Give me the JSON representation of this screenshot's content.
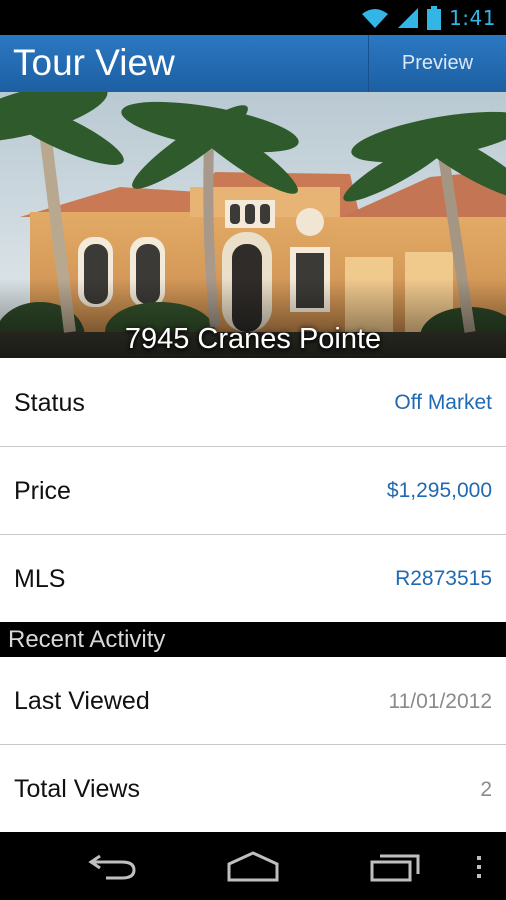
{
  "status_bar": {
    "time": "1:41",
    "icons": [
      "wifi-icon",
      "signal-icon",
      "battery-icon"
    ]
  },
  "action_bar": {
    "title": "Tour View",
    "preview_label": "Preview"
  },
  "hero": {
    "address": "7945 Cranes Pointe"
  },
  "details": [
    {
      "label": "Status",
      "value": "Off Market"
    },
    {
      "label": "Price",
      "value": "$1,295,000"
    },
    {
      "label": "MLS",
      "value": "R2873515"
    }
  ],
  "recent_activity": {
    "header": "Recent Activity",
    "items": [
      {
        "label": "Last Viewed",
        "value": "11/01/2012"
      },
      {
        "label": "Total Views",
        "value": "2"
      }
    ]
  },
  "nav_bar": {
    "buttons": [
      "back-icon",
      "home-icon",
      "recent-apps-icon",
      "overflow-menu-icon"
    ]
  },
  "colors": {
    "action_bar": "#2266b0",
    "value_blue": "#1f6ab3",
    "value_grey": "#8a8a8a",
    "status_icons": "#33b5e5"
  }
}
